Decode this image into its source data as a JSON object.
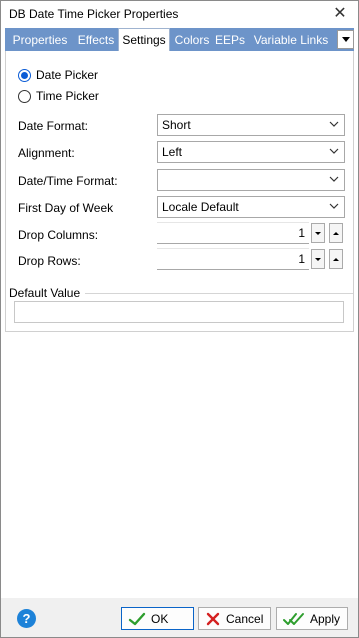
{
  "window": {
    "title": "DB Date Time Picker Properties",
    "close_glyph": "✕"
  },
  "tabs": [
    {
      "label": "Properties"
    },
    {
      "label": "Effects"
    },
    {
      "label": "Settings",
      "active": true
    },
    {
      "label": "Colors"
    },
    {
      "label": "EEPs"
    },
    {
      "label": "Variable Links"
    }
  ],
  "picker_type": {
    "options": [
      "Date Picker",
      "Time Picker"
    ],
    "selected": "Date Picker"
  },
  "fields": {
    "date_format": {
      "label": "Date Format:",
      "value": "Short"
    },
    "alignment": {
      "label": "Alignment:",
      "value": "Left"
    },
    "datetime_format": {
      "label": "Date/Time Format:",
      "value": ""
    },
    "first_day": {
      "label": "First Day of Week",
      "value": "Locale Default"
    },
    "drop_columns": {
      "label": "Drop Columns:",
      "value": "1"
    },
    "drop_rows": {
      "label": "Drop Rows:",
      "value": "1"
    }
  },
  "default_value": {
    "label": "Default Value",
    "value": ""
  },
  "footer": {
    "help_glyph": "?",
    "ok": "OK",
    "cancel": "Cancel",
    "apply": "Apply"
  },
  "colors": {
    "tab_bar": "#6d94c9",
    "accent": "#0b5cd6",
    "ok_icon": "#2e9e2e",
    "cancel_icon": "#d42020"
  },
  "icons": {
    "close": "close-icon",
    "help": "help-icon",
    "ok": "checkmark-icon",
    "cancel": "cancel-x-icon",
    "apply": "double-checkmark-icon"
  }
}
